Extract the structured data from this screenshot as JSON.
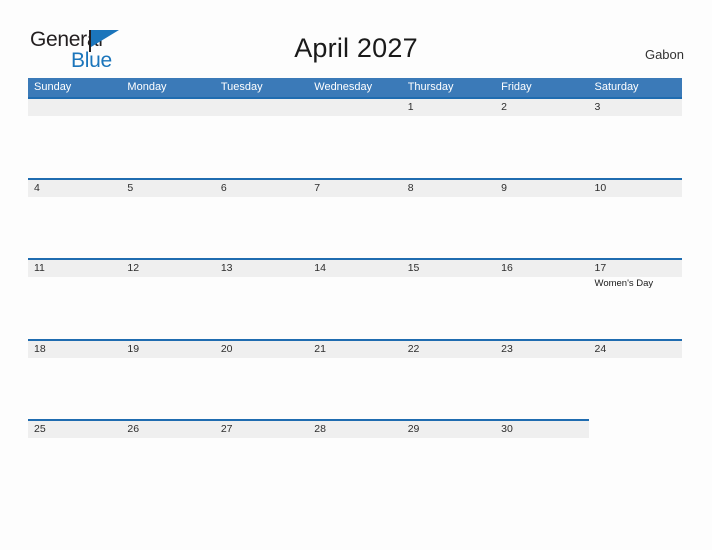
{
  "brand": {
    "name_part1": "General",
    "name_part2": "Blue",
    "flag_icon": "blue-flag-triangle",
    "color_dark": "#231f20",
    "color_blue": "#1b75bb"
  },
  "header": {
    "title": "April 2027",
    "country": "Gabon"
  },
  "calendar": {
    "header_bg": "#3b7ab8",
    "band_bg": "#efefef",
    "band_rule": "#1f6cb0",
    "weekdays": [
      "Sunday",
      "Monday",
      "Tuesday",
      "Wednesday",
      "Thursday",
      "Friday",
      "Saturday"
    ],
    "weeks": [
      [
        {
          "day": "",
          "events": []
        },
        {
          "day": "",
          "events": []
        },
        {
          "day": "",
          "events": []
        },
        {
          "day": "",
          "events": []
        },
        {
          "day": "1",
          "events": []
        },
        {
          "day": "2",
          "events": []
        },
        {
          "day": "3",
          "events": []
        }
      ],
      [
        {
          "day": "4",
          "events": []
        },
        {
          "day": "5",
          "events": []
        },
        {
          "day": "6",
          "events": []
        },
        {
          "day": "7",
          "events": []
        },
        {
          "day": "8",
          "events": []
        },
        {
          "day": "9",
          "events": []
        },
        {
          "day": "10",
          "events": []
        }
      ],
      [
        {
          "day": "11",
          "events": []
        },
        {
          "day": "12",
          "events": []
        },
        {
          "day": "13",
          "events": []
        },
        {
          "day": "14",
          "events": []
        },
        {
          "day": "15",
          "events": []
        },
        {
          "day": "16",
          "events": []
        },
        {
          "day": "17",
          "events": [
            "Women's Day"
          ]
        }
      ],
      [
        {
          "day": "18",
          "events": []
        },
        {
          "day": "19",
          "events": []
        },
        {
          "day": "20",
          "events": []
        },
        {
          "day": "21",
          "events": []
        },
        {
          "day": "22",
          "events": []
        },
        {
          "day": "23",
          "events": []
        },
        {
          "day": "24",
          "events": []
        }
      ],
      [
        {
          "day": "25",
          "events": []
        },
        {
          "day": "26",
          "events": []
        },
        {
          "day": "27",
          "events": []
        },
        {
          "day": "28",
          "events": []
        },
        {
          "day": "29",
          "events": []
        },
        {
          "day": "30",
          "events": []
        },
        {
          "day": "",
          "events": []
        }
      ]
    ]
  }
}
